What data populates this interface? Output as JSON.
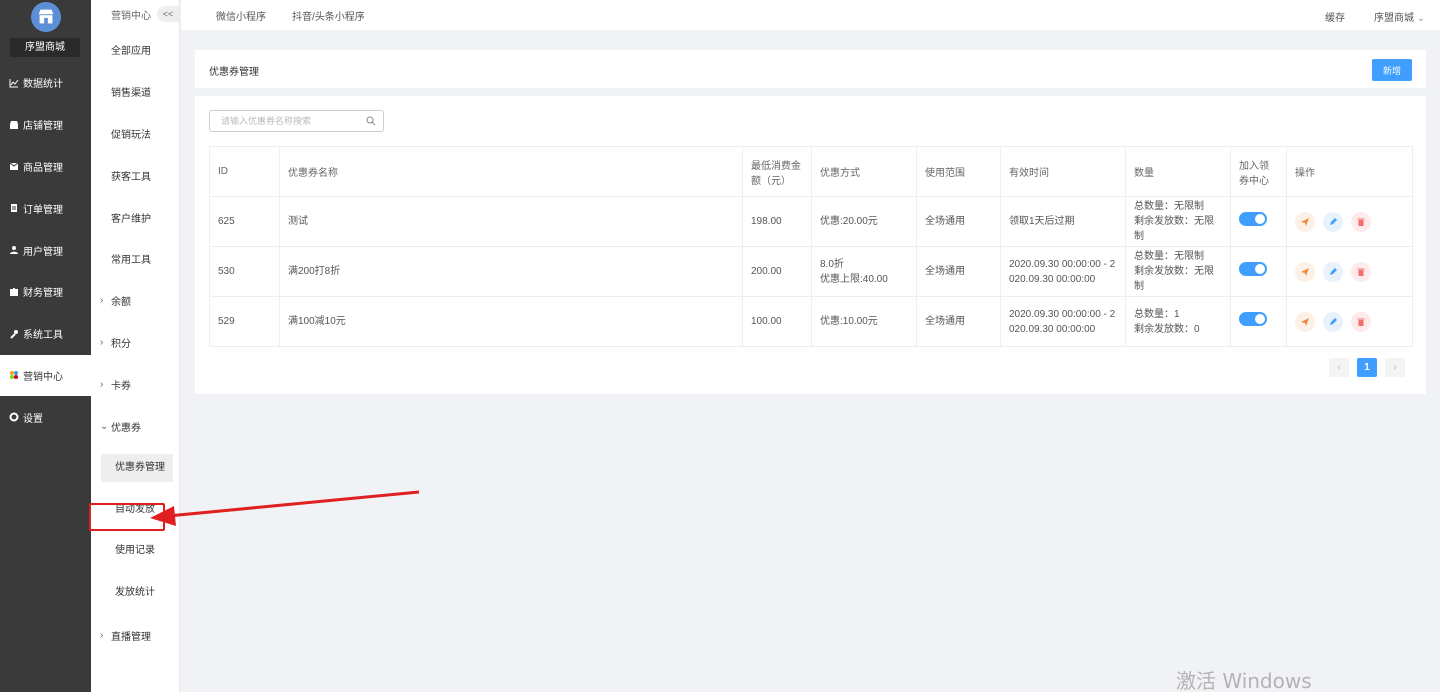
{
  "sidebar": {
    "shop_name": "序盟商城",
    "items": [
      {
        "label": "数据统计",
        "icon": "chart-icon"
      },
      {
        "label": "店铺管理",
        "icon": "store-icon"
      },
      {
        "label": "商品管理",
        "icon": "goods-icon"
      },
      {
        "label": "订单管理",
        "icon": "order-icon"
      },
      {
        "label": "用户管理",
        "icon": "user-icon"
      },
      {
        "label": "财务管理",
        "icon": "finance-icon"
      },
      {
        "label": "系统工具",
        "icon": "wrench-icon"
      },
      {
        "label": "营销中心",
        "icon": "marketing-icon",
        "active": true
      },
      {
        "label": "设置",
        "icon": "gear-icon"
      }
    ]
  },
  "subnav": {
    "title": "营销中心",
    "collapse": "<<",
    "items": [
      "全部应用",
      "销售渠道",
      "促销玩法",
      "获客工具",
      "客户维护",
      "常用工具"
    ],
    "groups": [
      "余额",
      "积分",
      "卡券",
      "优惠券"
    ],
    "coupon_children": [
      "优惠券管理",
      "自动发放",
      "使用记录",
      "发放统计"
    ],
    "live": "直播管理"
  },
  "topbar": {
    "tabs": [
      "微信小程序",
      "抖音/头条小程序"
    ],
    "cache": "缓存",
    "account": "序盟商城"
  },
  "page": {
    "title": "优惠券管理",
    "add_label": "新增",
    "search_placeholder": "请输入优惠券名称搜索"
  },
  "table": {
    "headers": [
      "ID",
      "优惠券名称",
      "最低消费金额（元）",
      "优惠方式",
      "使用范围",
      "有效时间",
      "数量",
      "加入领券中心",
      "操作"
    ],
    "rows": [
      {
        "id": "625",
        "name": "测试",
        "min": "198.00",
        "discount": "优惠:20.00元",
        "discount2": "",
        "scope": "全场通用",
        "time": "领取1天后过期",
        "qty1": "总数量：无限制",
        "qty2": "剩余发放数：无限制"
      },
      {
        "id": "530",
        "name": "满200打8折",
        "min": "200.00",
        "discount": "8.0折",
        "discount2": "优惠上限:40.00",
        "scope": "全场通用",
        "time": "2020.09.30 00:00:00 - 2020.09.30 00:00:00",
        "qty1": "总数量：无限制",
        "qty2": "剩余发放数：无限制"
      },
      {
        "id": "529",
        "name": "满100减10元",
        "min": "100.00",
        "discount": "优惠:10.00元",
        "discount2": "",
        "scope": "全场通用",
        "time": "2020.09.30 00:00:00 - 2020.09.30 00:00:00",
        "qty1": "总数量：1",
        "qty2": "剩余发放数：0"
      }
    ]
  },
  "pager": {
    "prev": "‹",
    "current": "1",
    "next": "›"
  },
  "watermark": "激活 Windows",
  "colors": {
    "primary": "#409eff",
    "sidebar": "#3a3a3a",
    "annotation": "#e02020"
  }
}
